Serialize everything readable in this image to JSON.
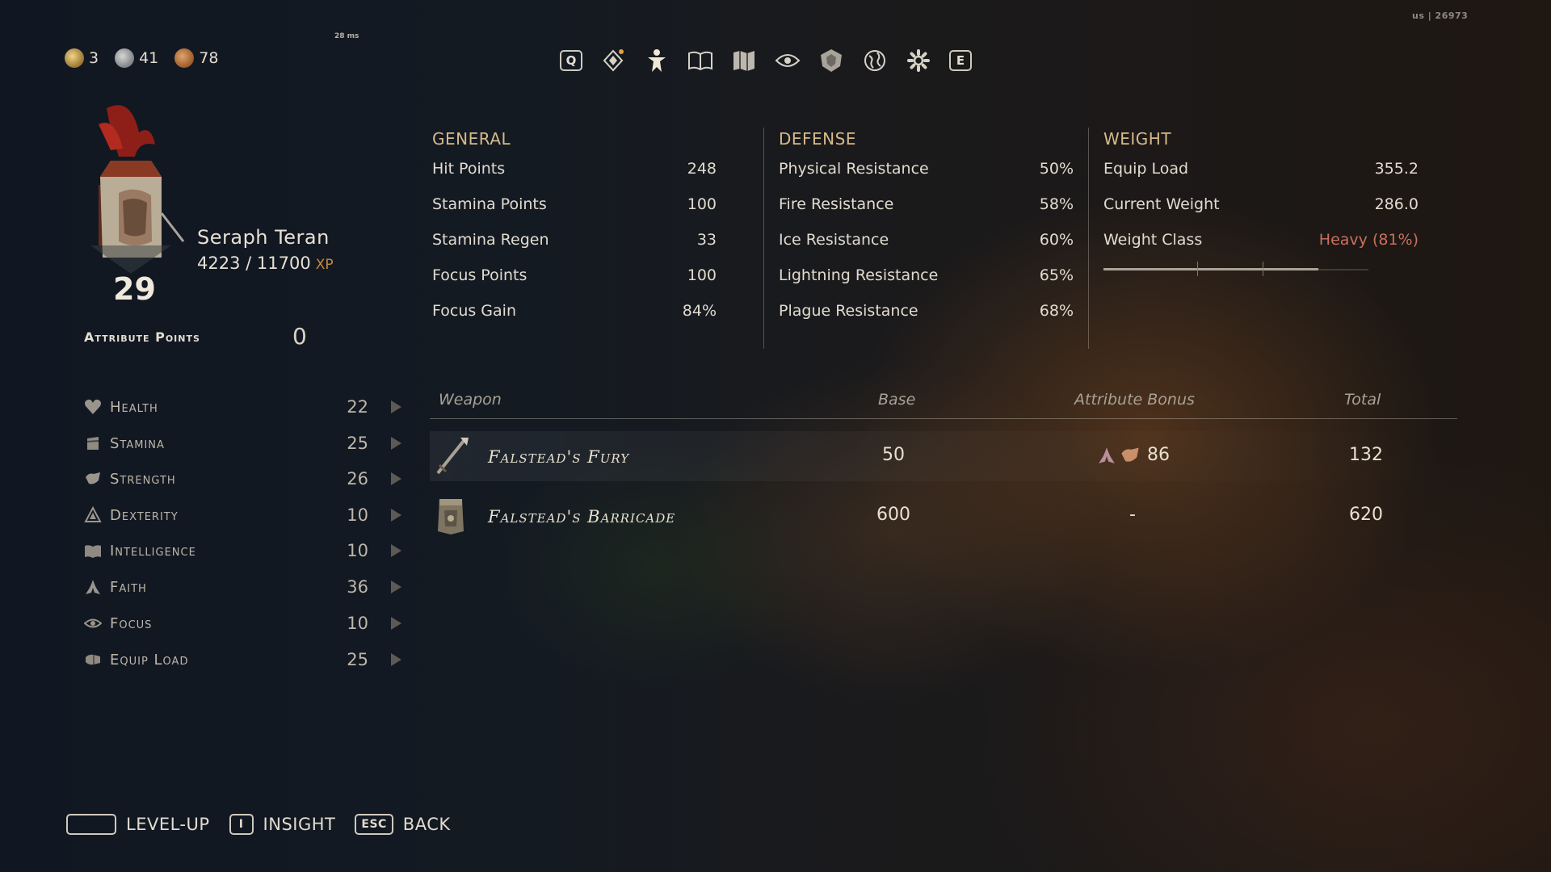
{
  "hud": {
    "currency": [
      {
        "icon": "gold-coin-icon",
        "value": "3"
      },
      {
        "icon": "silver-coin-icon",
        "value": "41"
      },
      {
        "icon": "bronze-coin-icon",
        "value": "78"
      }
    ],
    "latency": "28 ms",
    "region": "us | 26973"
  },
  "nav": {
    "prev_key": "Q",
    "next_key": "E",
    "icons": [
      "gem-icon",
      "character-icon",
      "book-icon",
      "map-icon",
      "eye-icon",
      "shield-emblem-icon",
      "globe-icon",
      "gear-icon"
    ]
  },
  "character": {
    "name": "Seraph Teran",
    "xp": "4223 / 11700",
    "xp_label": "XP",
    "level": "29",
    "attribute_points_label": "Attribute Points",
    "attribute_points_value": "0"
  },
  "attributes": [
    {
      "name": "Health",
      "value": "22",
      "icon": "heart-icon"
    },
    {
      "name": "Stamina",
      "value": "25",
      "icon": "stamina-icon"
    },
    {
      "name": "Strength",
      "value": "26",
      "icon": "strength-icon"
    },
    {
      "name": "Dexterity",
      "value": "10",
      "icon": "dexterity-icon"
    },
    {
      "name": "Intelligence",
      "value": "10",
      "icon": "intelligence-icon"
    },
    {
      "name": "Faith",
      "value": "36",
      "icon": "faith-icon"
    },
    {
      "name": "Focus",
      "value": "10",
      "icon": "focus-eye-icon"
    },
    {
      "name": "Equip Load",
      "value": "25",
      "icon": "equip-load-icon"
    }
  ],
  "general": {
    "title": "GENERAL",
    "rows": [
      {
        "label": "Hit Points",
        "value": "248"
      },
      {
        "label": "Stamina Points",
        "value": "100"
      },
      {
        "label": "Stamina Regen",
        "value": "33"
      },
      {
        "label": "Focus Points",
        "value": "100"
      },
      {
        "label": "Focus Gain",
        "value": "84%"
      }
    ]
  },
  "defense": {
    "title": "DEFENSE",
    "rows": [
      {
        "label": "Physical Resistance",
        "value": "50%"
      },
      {
        "label": "Fire Resistance",
        "value": "58%"
      },
      {
        "label": "Ice Resistance",
        "value": "60%"
      },
      {
        "label": "Lightning Resistance",
        "value": "65%"
      },
      {
        "label": "Plague Resistance",
        "value": "68%"
      }
    ]
  },
  "weight": {
    "title": "WEIGHT",
    "rows": [
      {
        "label": "Equip Load",
        "value": "355.2"
      },
      {
        "label": "Current Weight",
        "value": "286.0"
      },
      {
        "label": "Weight Class",
        "value": "Heavy (81%)"
      }
    ],
    "fill_fraction": 0.81,
    "colors": {
      "heavy": "#c9705e"
    }
  },
  "weapons": {
    "headers": {
      "weapon": "Weapon",
      "base": "Base",
      "bonus": "Attribute Bonus",
      "total": "Total"
    },
    "rows": [
      {
        "name": "Falstead's Fury",
        "base": "50",
        "bonus": "86",
        "total": "132",
        "icon": "spear-icon",
        "bonus_icons": [
          "faith-icon",
          "strength-icon"
        ]
      },
      {
        "name": "Falstead's Barricade",
        "base": "600",
        "bonus": "-",
        "total": "620",
        "icon": "tower-shield-icon",
        "bonus_icons": []
      }
    ]
  },
  "controls": [
    {
      "key": "",
      "label": "LEVEL-UP"
    },
    {
      "key": "I",
      "label": "INSIGHT"
    },
    {
      "key": "ESC",
      "label": "BACK"
    }
  ]
}
